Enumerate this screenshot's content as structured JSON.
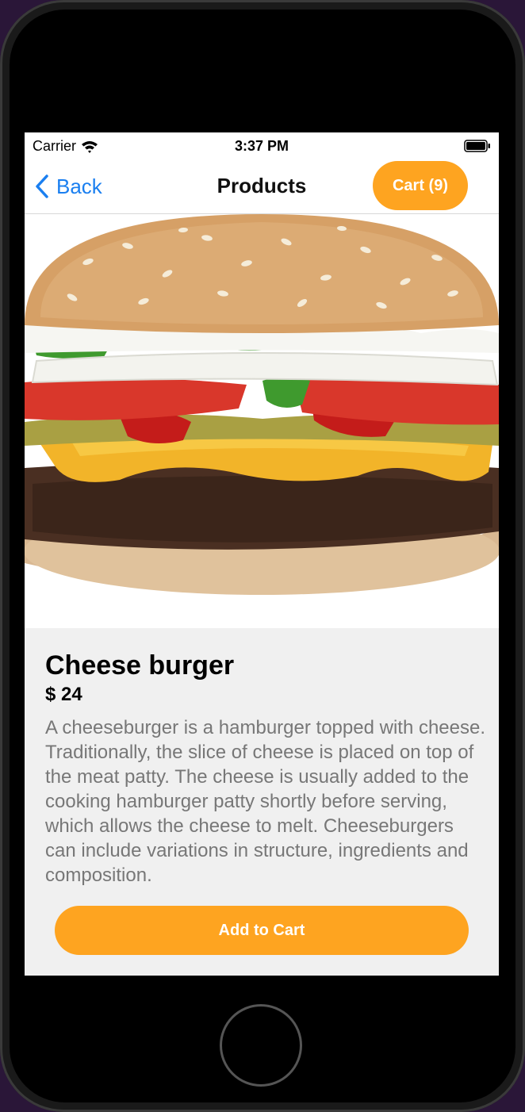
{
  "status_bar": {
    "carrier": "Carrier",
    "time": "3:37 PM",
    "icons": [
      "wifi-icon",
      "battery-icon"
    ]
  },
  "nav": {
    "back_label": "Back",
    "title": "Products",
    "cart_label": "Cart (9)",
    "back_icon": "chevron-left-icon"
  },
  "product": {
    "name": "Cheese burger",
    "price": "$ 24",
    "description": "A cheeseburger is a hamburger topped with cheese. Traditionally, the slice of cheese is placed on top of the meat patty. The cheese is usually added to the cooking hamburger patty shortly before serving, which allows the cheese to melt. Cheeseburgers can include variations in structure, ingredients and composition.",
    "image": "cheeseburger-photo",
    "add_to_cart_label": "Add to Cart"
  },
  "colors": {
    "accent": "#fea420",
    "link": "#1a7ff0",
    "details_bg": "#f0f0f0",
    "description_text": "#777777"
  }
}
